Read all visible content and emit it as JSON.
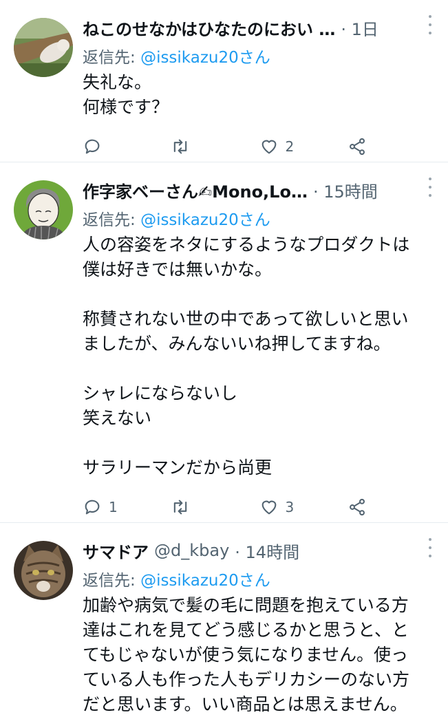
{
  "tweets": [
    {
      "name": "ねこのせなかはひなたのにおい …",
      "handle": "",
      "time": "· 1日",
      "reply_prefix": "返信先: ",
      "reply_to": "@issikazu20さん",
      "body": "失礼な。\n何様です？",
      "reply_count": "",
      "retweet_count": "",
      "like_count": "2"
    },
    {
      "name": "作字家ベーさん✍Mono,Lo…",
      "handle": "",
      "time": "· 15時間",
      "reply_prefix": "返信先: ",
      "reply_to": "@issikazu20さん",
      "body": "人の容姿をネタにするようなプロダクトは\n僕は好きでは無いかな。\n\n称賛されない世の中であって欲しいと思い\nましたが、みんないいね押してますね。\n\nシャレにならないし\n笑えない\n\nサラリーマンだから尚更",
      "reply_count": "1",
      "retweet_count": "",
      "like_count": "3"
    },
    {
      "name": "サマドア",
      "handle": "@d_kbay",
      "time": "· 14時間",
      "reply_prefix": "返信先: ",
      "reply_to": "@issikazu20さん",
      "body": "加齢や病気で髪の毛に問題を抱えている方\n達はこれを見てどう感じるかと思うと、と\nてもじゃないが使う気になりません。使っ\nている人も作った人もデリカシーのない方\nだと思います。いい商品とは思えません。",
      "reply_count": "",
      "retweet_count": "",
      "like_count": ""
    }
  ]
}
